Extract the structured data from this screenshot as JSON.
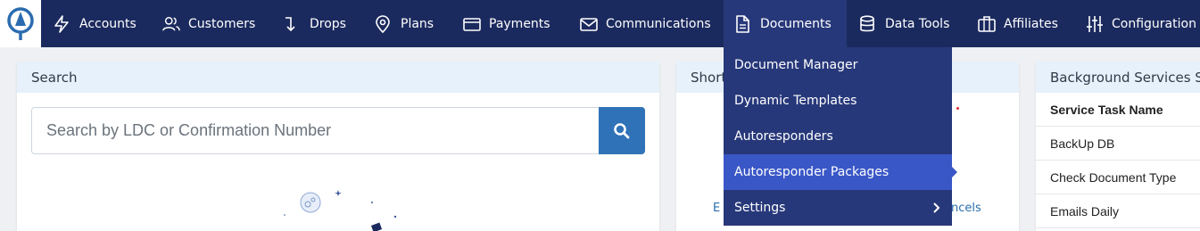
{
  "nav": {
    "items": [
      {
        "label": "Accounts",
        "icon": "bolt-icon"
      },
      {
        "label": "Customers",
        "icon": "users-icon"
      },
      {
        "label": "Drops",
        "icon": "drop-arrow-icon"
      },
      {
        "label": "Plans",
        "icon": "map-pin-icon"
      },
      {
        "label": "Payments",
        "icon": "credit-card-icon"
      },
      {
        "label": "Communications",
        "icon": "mail-icon"
      },
      {
        "label": "Documents",
        "icon": "document-icon"
      },
      {
        "label": "Data Tools",
        "icon": "database-icon"
      },
      {
        "label": "Affiliates",
        "icon": "briefcase-icon"
      },
      {
        "label": "Configuration",
        "icon": "sliders-icon"
      }
    ],
    "active": "Documents"
  },
  "search_card": {
    "title": "Search",
    "placeholder": "Search by LDC or Confirmation Number"
  },
  "shortcuts_card": {
    "title": "Short",
    "link_left": "E",
    "link_right": "ncels"
  },
  "background_card": {
    "title": "Background Services S",
    "column_header": "Service Task Name",
    "rows": [
      "BackUp DB",
      "Check Document Type",
      "Emails Daily"
    ]
  },
  "documents_menu": {
    "items": [
      {
        "label": "Document Manager"
      },
      {
        "label": "Dynamic Templates"
      },
      {
        "label": "Autoresponders"
      },
      {
        "label": "Autoresponder Packages"
      },
      {
        "label": "Settings"
      }
    ],
    "selected": "Autoresponder Packages"
  },
  "colors": {
    "nav_bg": "#1b2a5e",
    "menu_bg": "#27387a",
    "menu_selected": "#3a57c7",
    "card_header": "#e6f1fb",
    "search_button": "#2f72b8"
  }
}
